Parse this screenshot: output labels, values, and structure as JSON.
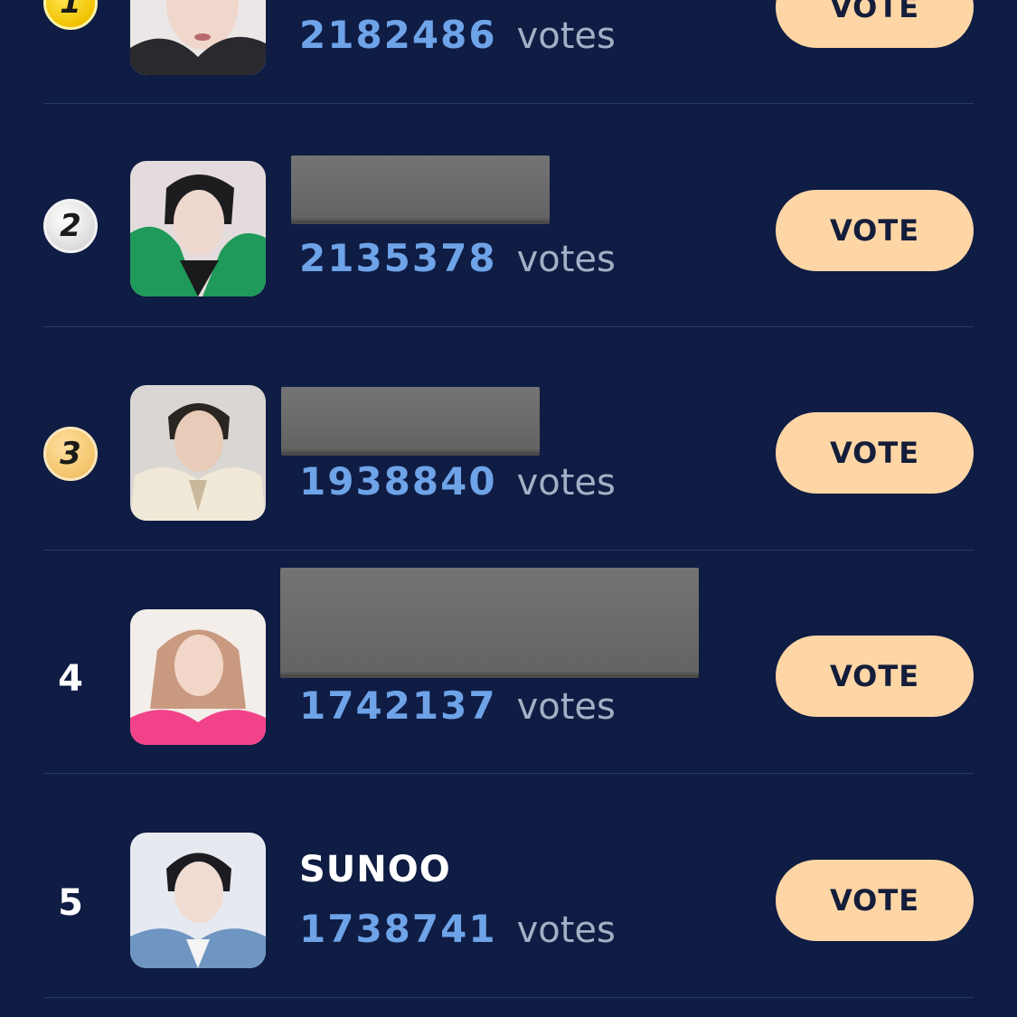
{
  "theme": {
    "background": "#0f1c43",
    "vote_button_bg": "#fed6a6",
    "vote_count_color": "#6ea3e8",
    "votes_label_color": "#a4afc6"
  },
  "leaderboard": {
    "entries": [
      {
        "rank": "1",
        "name": "",
        "votes": "2182486",
        "votes_label": "votes",
        "button_label": "VOTE",
        "medal": "gold-medal-icon"
      },
      {
        "rank": "2",
        "name": "",
        "votes": "2135378",
        "votes_label": "votes",
        "button_label": "VOTE",
        "medal": "silver-medal-icon"
      },
      {
        "rank": "3",
        "name": "",
        "votes": "1938840",
        "votes_label": "votes",
        "button_label": "VOTE",
        "medal": "bronze-medal-icon"
      },
      {
        "rank": "4",
        "name": "",
        "votes": "1742137",
        "votes_label": "votes",
        "button_label": "VOTE",
        "medal": ""
      },
      {
        "rank": "5",
        "name": "SUNOO",
        "votes": "1738741",
        "votes_label": "votes",
        "button_label": "VOTE",
        "medal": ""
      }
    ]
  }
}
